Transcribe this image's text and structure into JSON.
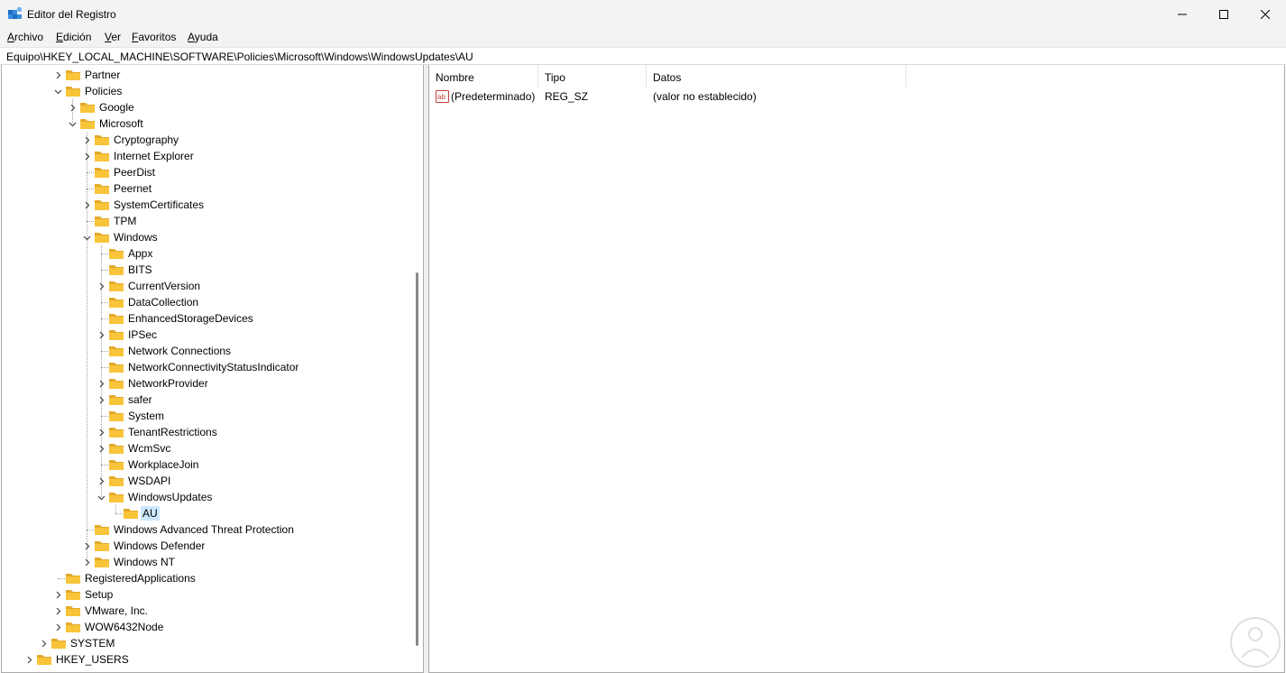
{
  "window": {
    "title": "Editor del Registro",
    "minimize_label": "minimize",
    "maximize_label": "maximize",
    "close_label": "close"
  },
  "menu": {
    "items": [
      {
        "underline": "A",
        "rest": "rchivo"
      },
      {
        "underline": "E",
        "rest": "dición"
      },
      {
        "underline": "V",
        "rest": "er"
      },
      {
        "underline": "F",
        "rest": "avoritos"
      },
      {
        "underline": "A",
        "rest": "yuda"
      }
    ]
  },
  "address": {
    "path": "Equipo\\HKEY_LOCAL_MACHINE\\SOFTWARE\\Policies\\Microsoft\\Windows\\WindowsUpdates\\AU"
  },
  "tree": {
    "items": [
      {
        "label": "Partner",
        "level": 3,
        "expander": "collapsed"
      },
      {
        "label": "Policies",
        "level": 3,
        "expander": "expanded"
      },
      {
        "label": "Google",
        "level": 4,
        "expander": "collapsed"
      },
      {
        "label": "Microsoft",
        "level": 4,
        "expander": "expanded"
      },
      {
        "label": "Cryptography",
        "level": 5,
        "expander": "collapsed"
      },
      {
        "label": "Internet Explorer",
        "level": 5,
        "expander": "collapsed"
      },
      {
        "label": "PeerDist",
        "level": 5,
        "expander": "none"
      },
      {
        "label": "Peernet",
        "level": 5,
        "expander": "none"
      },
      {
        "label": "SystemCertificates",
        "level": 5,
        "expander": "collapsed"
      },
      {
        "label": "TPM",
        "level": 5,
        "expander": "none"
      },
      {
        "label": "Windows",
        "level": 5,
        "expander": "expanded"
      },
      {
        "label": "Appx",
        "level": 6,
        "expander": "none"
      },
      {
        "label": "BITS",
        "level": 6,
        "expander": "none"
      },
      {
        "label": "CurrentVersion",
        "level": 6,
        "expander": "collapsed"
      },
      {
        "label": "DataCollection",
        "level": 6,
        "expander": "none"
      },
      {
        "label": "EnhancedStorageDevices",
        "level": 6,
        "expander": "none"
      },
      {
        "label": "IPSec",
        "level": 6,
        "expander": "collapsed"
      },
      {
        "label": "Network Connections",
        "level": 6,
        "expander": "none"
      },
      {
        "label": "NetworkConnectivityStatusIndicator",
        "level": 6,
        "expander": "none"
      },
      {
        "label": "NetworkProvider",
        "level": 6,
        "expander": "collapsed"
      },
      {
        "label": "safer",
        "level": 6,
        "expander": "collapsed"
      },
      {
        "label": "System",
        "level": 6,
        "expander": "none"
      },
      {
        "label": "TenantRestrictions",
        "level": 6,
        "expander": "collapsed"
      },
      {
        "label": "WcmSvc",
        "level": 6,
        "expander": "collapsed"
      },
      {
        "label": "WorkplaceJoin",
        "level": 6,
        "expander": "none"
      },
      {
        "label": "WSDAPI",
        "level": 6,
        "expander": "collapsed"
      },
      {
        "label": "WindowsUpdates",
        "level": 6,
        "expander": "expanded"
      },
      {
        "label": "AU",
        "level": 7,
        "expander": "none",
        "selected": true
      },
      {
        "label": "Windows Advanced Threat Protection",
        "level": 5,
        "expander": "none"
      },
      {
        "label": "Windows Defender",
        "level": 5,
        "expander": "collapsed"
      },
      {
        "label": "Windows NT",
        "level": 5,
        "expander": "collapsed"
      },
      {
        "label": "RegisteredApplications",
        "level": 3,
        "expander": "none"
      },
      {
        "label": "Setup",
        "level": 3,
        "expander": "collapsed"
      },
      {
        "label": "VMware, Inc.",
        "level": 3,
        "expander": "collapsed"
      },
      {
        "label": "WOW6432Node",
        "level": 3,
        "expander": "collapsed"
      },
      {
        "label": "SYSTEM",
        "level": 2,
        "expander": "collapsed"
      },
      {
        "label": "HKEY_USERS",
        "level": 1,
        "expander": "collapsed"
      }
    ]
  },
  "list": {
    "columns": [
      "Nombre",
      "Tipo",
      "Datos"
    ],
    "rows": [
      {
        "name": "(Predeterminado)",
        "type": "REG_SZ",
        "data": "(valor no establecido)",
        "icon": "string-value-icon"
      }
    ]
  },
  "colors": {
    "folder": "#f8c43a",
    "folder_dark": "#e2a92a",
    "selection": "#cce8ff",
    "chrome": "#f3f3f3"
  }
}
